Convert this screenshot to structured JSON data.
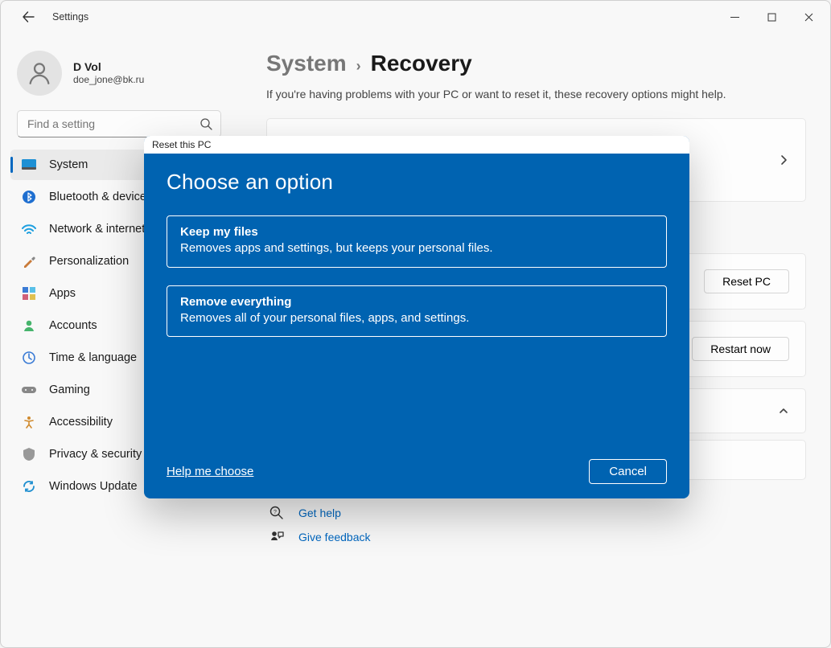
{
  "app": {
    "title": "Settings"
  },
  "window_controls": {
    "min": "minimize",
    "max": "maximize",
    "close": "close"
  },
  "profile": {
    "name": "D Vol",
    "email": "doe_jone@bk.ru"
  },
  "search": {
    "placeholder": "Find a setting"
  },
  "sidebar": {
    "items": [
      {
        "label": "System",
        "icon": "system-icon",
        "selected": true
      },
      {
        "label": "Bluetooth & devices",
        "icon": "bluetooth-icon",
        "selected": false
      },
      {
        "label": "Network & internet",
        "icon": "network-icon",
        "selected": false
      },
      {
        "label": "Personalization",
        "icon": "personalization-icon",
        "selected": false
      },
      {
        "label": "Apps",
        "icon": "apps-icon",
        "selected": false
      },
      {
        "label": "Accounts",
        "icon": "accounts-icon",
        "selected": false
      },
      {
        "label": "Time & language",
        "icon": "time-language-icon",
        "selected": false
      },
      {
        "label": "Gaming",
        "icon": "gaming-icon",
        "selected": false
      },
      {
        "label": "Accessibility",
        "icon": "accessibility-icon",
        "selected": false
      },
      {
        "label": "Privacy & security",
        "icon": "privacy-icon",
        "selected": false
      },
      {
        "label": "Windows Update",
        "icon": "update-icon",
        "selected": false
      }
    ]
  },
  "breadcrumb": {
    "parent": "System",
    "current": "Recovery"
  },
  "page": {
    "subtitle": "If you're having problems with your PC or want to reset it, these recovery options might help."
  },
  "cards": {
    "reset": {
      "button": "Reset PC"
    },
    "restart": {
      "button": "Restart now"
    }
  },
  "footer": {
    "help": "Get help",
    "feedback": "Give feedback"
  },
  "dialog": {
    "title": "Reset this PC",
    "heading": "Choose an option",
    "options": [
      {
        "title": "Keep my files",
        "desc": "Removes apps and settings, but keeps your personal files."
      },
      {
        "title": "Remove everything",
        "desc": "Removes all of your personal files, apps, and settings."
      }
    ],
    "help_link": "Help me choose",
    "cancel": "Cancel"
  }
}
